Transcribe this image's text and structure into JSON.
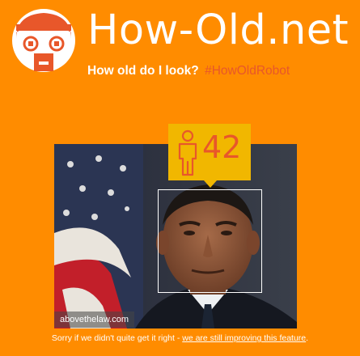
{
  "header": {
    "title": "How-Old.net",
    "tagline": "How old do I look?",
    "hashtag": "#HowOldRobot",
    "logo_icon": "robot-face-logo"
  },
  "result": {
    "age": "42",
    "gender_icon": "person-icon"
  },
  "photo": {
    "watermark": "abovethelaw.com"
  },
  "footer": {
    "text": "Sorry if we didn't quite get it right - ",
    "link": "we are still improving this feature",
    "suffix": "."
  },
  "colors": {
    "background": "#ff8c00",
    "tag": "#f1b700",
    "accent": "#e8572a"
  }
}
